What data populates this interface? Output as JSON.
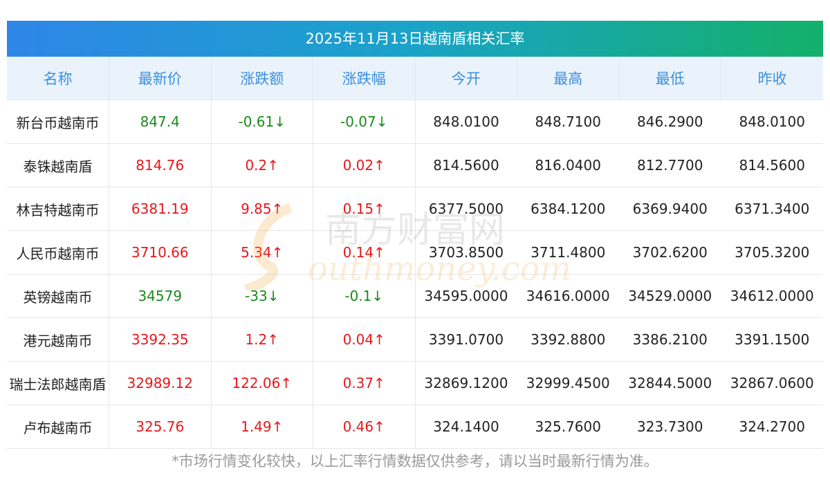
{
  "title": "2025年11月13日越南盾相关汇率",
  "headers": [
    "名称",
    "最新价",
    "涨跌额",
    "涨跌幅",
    "今开",
    "最高",
    "最低",
    "昨收"
  ],
  "rows": [
    {
      "name": "新台币越南币",
      "latest": "847.4",
      "change": "-0.61↓",
      "pct": "-0.07↓",
      "open": "848.0100",
      "high": "848.7100",
      "low": "846.2900",
      "prev": "848.0100",
      "dir": "down"
    },
    {
      "name": "泰铢越南盾",
      "latest": "814.76",
      "change": "0.2↑",
      "pct": "0.02↑",
      "open": "814.5600",
      "high": "816.0400",
      "low": "812.7700",
      "prev": "814.5600",
      "dir": "up"
    },
    {
      "name": "林吉特越南币",
      "latest": "6381.19",
      "change": "9.85↑",
      "pct": "0.15↑",
      "open": "6377.5000",
      "high": "6384.1200",
      "low": "6369.9400",
      "prev": "6371.3400",
      "dir": "up"
    },
    {
      "name": "人民币越南币",
      "latest": "3710.66",
      "change": "5.34↑",
      "pct": "0.14↑",
      "open": "3703.8500",
      "high": "3711.4800",
      "low": "3702.6200",
      "prev": "3705.3200",
      "dir": "up"
    },
    {
      "name": "英镑越南币",
      "latest": "34579",
      "change": "-33↓",
      "pct": "-0.1↓",
      "open": "34595.0000",
      "high": "34616.0000",
      "low": "34529.0000",
      "prev": "34612.0000",
      "dir": "down"
    },
    {
      "name": "港元越南币",
      "latest": "3392.35",
      "change": "1.2↑",
      "pct": "0.04↑",
      "open": "3391.0700",
      "high": "3392.8800",
      "low": "3386.2100",
      "prev": "3391.1500",
      "dir": "up"
    },
    {
      "name": "瑞士法郎越南盾",
      "latest": "32989.12",
      "change": "122.06↑",
      "pct": "0.37↑",
      "open": "32869.1200",
      "high": "32999.4500",
      "low": "32844.5000",
      "prev": "32867.0600",
      "dir": "up"
    },
    {
      "name": "卢布越南币",
      "latest": "325.76",
      "change": "1.49↑",
      "pct": "0.46↑",
      "open": "324.1400",
      "high": "325.7600",
      "low": "323.7300",
      "prev": "324.2700",
      "dir": "up"
    }
  ],
  "footer": "*市场行情变化较快，以上汇率行情数据仅供参考，请以当时最新行情为准。",
  "watermark": {
    "cn": "南方财富网",
    "en": "outhmoney.com"
  },
  "colors": {
    "up": "#e8171b",
    "down": "#1a8a1a",
    "header_text": "#3a8ee0",
    "title_grad_start": "#2e86e8",
    "title_grad_end": "#13b06a"
  }
}
